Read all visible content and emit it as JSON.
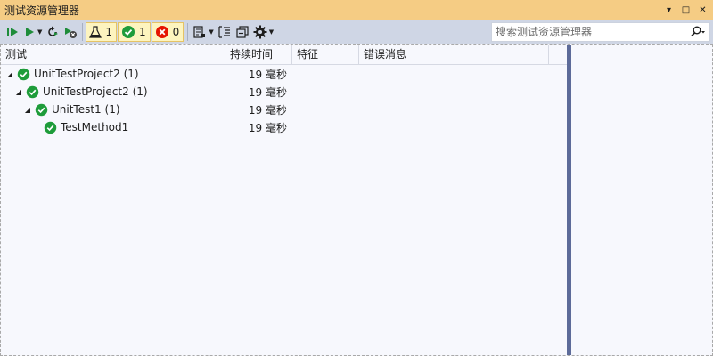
{
  "window": {
    "title": "测试资源管理器",
    "buttons": {
      "dropdown_glyph": "▾",
      "maximize_glyph": "□",
      "close_glyph": "✕"
    }
  },
  "toolbar": {
    "counters": [
      {
        "icon": "flask-icon",
        "value": "1"
      },
      {
        "icon": "passed-icon",
        "value": "1"
      },
      {
        "icon": "failed-icon",
        "value": "0"
      }
    ],
    "caret": "▼",
    "search": {
      "placeholder": "搜索测试资源管理器",
      "value": ""
    }
  },
  "grid": {
    "columns": [
      "测试",
      "持续时间",
      "特征",
      "错误消息"
    ],
    "rows": [
      {
        "name": "UnitTestProject2 (1)",
        "duration": "19 毫秒",
        "level": 0,
        "expanded": true
      },
      {
        "name": "UnitTestProject2 (1)",
        "duration": "19 毫秒",
        "level": 1,
        "expanded": true
      },
      {
        "name": "UnitTest1 (1)",
        "duration": "19 毫秒",
        "level": 2,
        "expanded": true
      },
      {
        "name": "TestMethod1",
        "duration": "19 毫秒",
        "level": 3,
        "expanded": null
      }
    ],
    "expander_glyph": "◢"
  },
  "colors": {
    "title_bar": "#f5cc84",
    "toolbar": "#cfd6e5",
    "pass_green": "#1e9c3a",
    "fail_red": "#e51400",
    "splitter": "#5d6b99"
  }
}
